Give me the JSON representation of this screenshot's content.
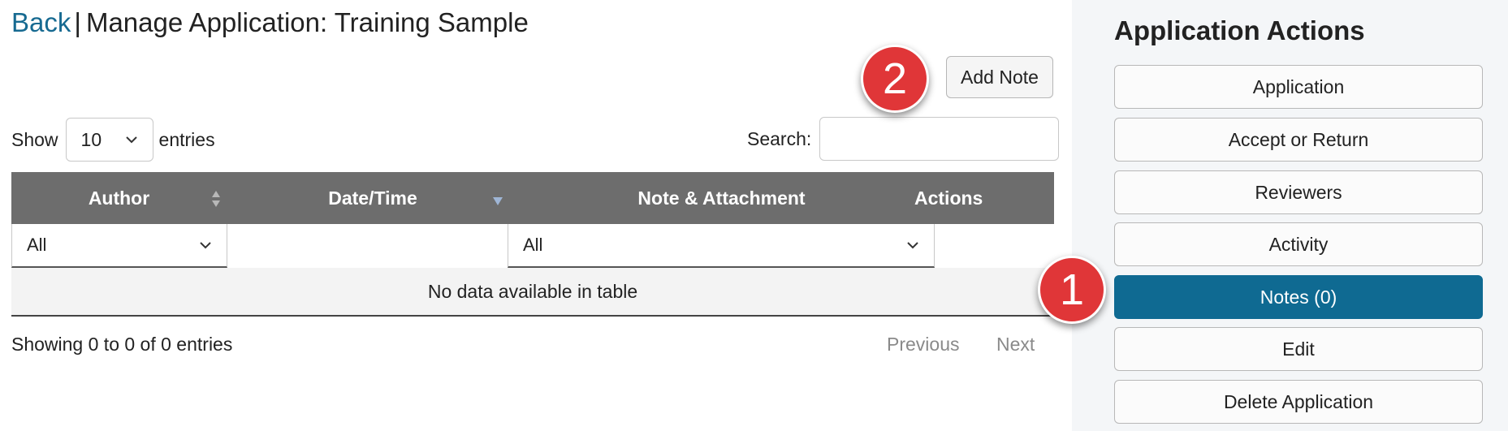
{
  "header": {
    "back_label": "Back",
    "separator": "|",
    "title": "Manage Application: Training Sample"
  },
  "toolbar": {
    "add_note_label": "Add Note"
  },
  "callouts": {
    "one": "1",
    "two": "2"
  },
  "table_controls": {
    "show_label": "Show",
    "entries_value": "10",
    "entries_label": "entries",
    "search_label": "Search:",
    "search_value": ""
  },
  "table": {
    "columns": [
      {
        "label": "Author"
      },
      {
        "label": "Date/Time"
      },
      {
        "label": "Note & Attachment"
      },
      {
        "label": "Actions"
      }
    ],
    "filters": {
      "author": "All",
      "note": "All"
    },
    "empty_message": "No data available in table"
  },
  "footer": {
    "info": "Showing 0 to 0 of 0 entries",
    "previous_label": "Previous",
    "next_label": "Next"
  },
  "sidebar": {
    "title": "Application Actions",
    "items": [
      {
        "label": "Application"
      },
      {
        "label": "Accept or Return"
      },
      {
        "label": "Reviewers"
      },
      {
        "label": "Activity"
      },
      {
        "label": "Notes (0)"
      },
      {
        "label": "Edit"
      },
      {
        "label": "Delete Application"
      }
    ]
  },
  "colors": {
    "accent": "#0f6a92",
    "link": "#176a91",
    "table_header": "#6d6d6d",
    "callout": "#e03638"
  }
}
